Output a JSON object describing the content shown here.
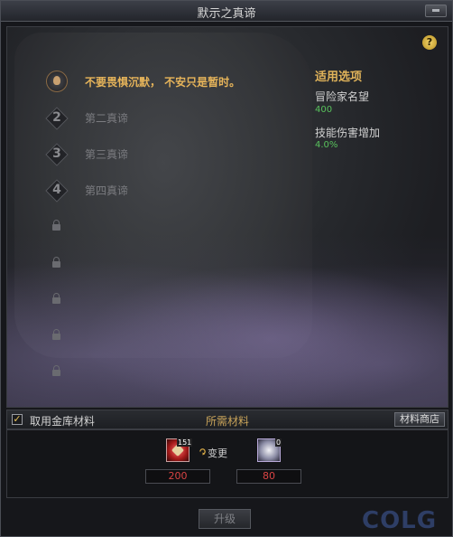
{
  "window": {
    "title": "默示之真谛"
  },
  "stages": [
    {
      "num": "",
      "label": "不要畏惧沉默，  不安只是暂时。",
      "state": "active"
    },
    {
      "num": "2",
      "label": "第二真谛",
      "state": "locked-num"
    },
    {
      "num": "3",
      "label": "第三真谛",
      "state": "locked-num"
    },
    {
      "num": "4",
      "label": "第四真谛",
      "state": "locked-num"
    }
  ],
  "options": {
    "title": "适用选项",
    "items": [
      {
        "name": "冒险家名望",
        "value": "400"
      },
      {
        "name": "技能伤害增加",
        "value": "4.0%"
      }
    ]
  },
  "materials_bar": {
    "checkbox_label": "取用金库材料",
    "checkbox_checked": true,
    "title": "所需材料",
    "shop_label": "材料商店"
  },
  "materials": {
    "item1_count": "151",
    "item2_count": "0",
    "change_label": "变更",
    "qty1": "200",
    "qty2": "80"
  },
  "upgrade_label": "升级",
  "watermark": "COLG"
}
